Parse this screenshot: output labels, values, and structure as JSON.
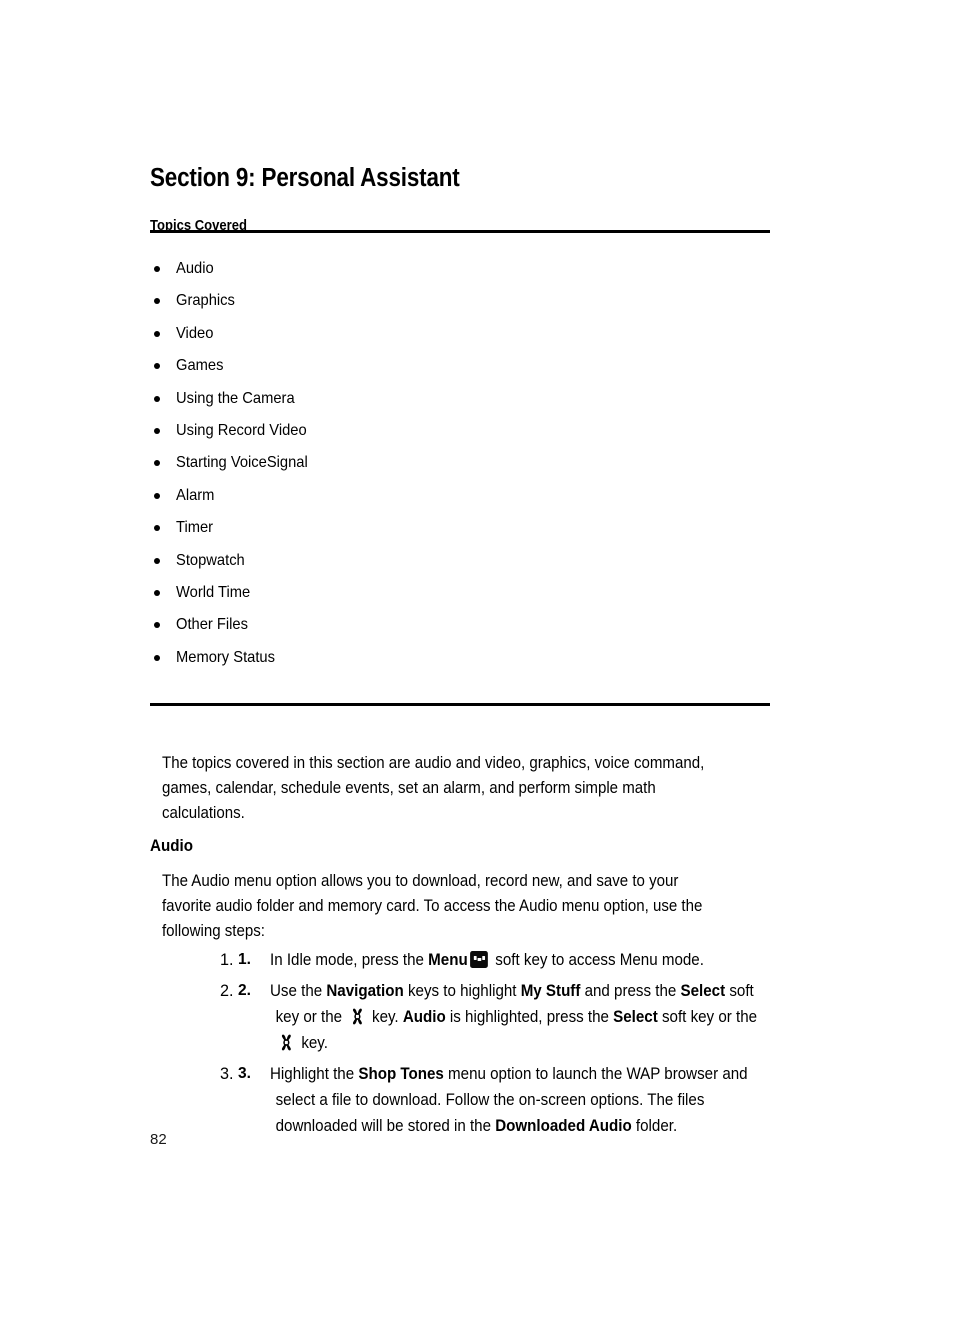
{
  "document": {
    "section_title": "Section 9: Personal Assistant",
    "page_number": "82"
  },
  "topics": {
    "heading": "Topics Covered",
    "items": [
      "Audio",
      "Graphics",
      "Video",
      "Games",
      "Using the Camera",
      "Using Record Video",
      "Starting VoiceSignal",
      "Alarm",
      "Timer",
      "Stopwatch",
      "World Time",
      "Other Files",
      "Memory Status"
    ]
  },
  "intro": {
    "line1": "The topics covered in this section are audio and video, graphics, voice command,",
    "line2": "games, calendar, schedule events, set an alarm, and perform simple math",
    "line3": "calculations."
  },
  "audio_section": {
    "heading": "Audio",
    "para_line1": "The Audio menu option allows you to download, record new, and save to your",
    "para_line2": "favorite audio folder and memory card. To access the Audio menu option, use the",
    "para_line3": "following steps:",
    "steps": [
      {
        "number": "1.",
        "seg1": "In Idle mode, press the ",
        "bold1": "Menu",
        "icon1": "menu-key-icon",
        "seg2": " soft key to access Menu mode."
      },
      {
        "number": "2.",
        "l1_seg1": "Use the ",
        "l1_bold1": "Navigation",
        "l1_seg2": " keys to highlight ",
        "l1_bold2": "My Stuff",
        "l1_seg3": " and press the ",
        "l1_bold3": "Select",
        "l1_seg4": " soft",
        "l2_seg1": "key or the ",
        "l2_icon": "ok-key-icon",
        "l2_seg2": " key. ",
        "l2_bold1": "Audio",
        "l2_seg3": " is highlighted, press the ",
        "l2_bold2": "Select",
        "l2_seg4": " soft key or the",
        "l3_icon": "ok-key-icon",
        "l3_seg1": " key."
      },
      {
        "number": "3.",
        "l1_seg1": "Highlight the ",
        "l1_bold1": "Shop Tones",
        "l1_seg2": " menu option to launch the WAP browser and",
        "l2_seg1": "select a file to download. Follow the on-screen options. The files",
        "l3_seg1": "downloaded will be stored in the ",
        "l3_bold1": "Downloaded Audio",
        "l3_seg2": " folder."
      }
    ]
  },
  "colors": {
    "text": "#000000",
    "rule": "#000000",
    "page_background": "#ffffff"
  }
}
